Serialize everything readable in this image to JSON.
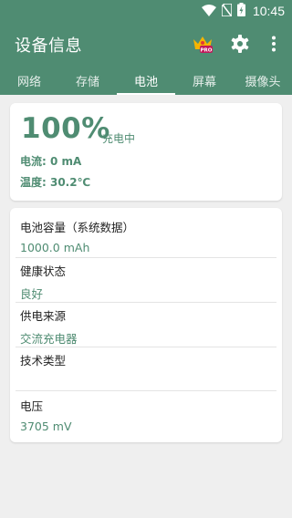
{
  "status_bar": {
    "time": "10:45"
  },
  "app": {
    "title": "设备信息"
  },
  "tabs": [
    {
      "label": "网络"
    },
    {
      "label": "存储"
    },
    {
      "label": "电池"
    },
    {
      "label": "屏幕"
    },
    {
      "label": "摄像头"
    }
  ],
  "battery": {
    "percent": "100%",
    "status": "充电中",
    "current": "电流: 0 mA",
    "temperature": "温度: 30.2℃"
  },
  "details": [
    {
      "label": "电池容量（系统数据）",
      "value": "1000.0 mAh"
    },
    {
      "label": "健康状态",
      "value": "良好"
    },
    {
      "label": "供电来源",
      "value": "交流充电器"
    },
    {
      "label": "技术类型",
      "value": ""
    },
    {
      "label": "电压",
      "value": "3705 mV"
    }
  ],
  "colors": {
    "accent": "#4f8c72",
    "background": "#efefef",
    "badge": "#c2185b",
    "crown": "#f5b400"
  },
  "icons": [
    "wifi-icon",
    "no-sim-icon",
    "battery-charging-icon",
    "crown-pro-icon",
    "gear-icon",
    "more-vert-icon"
  ]
}
